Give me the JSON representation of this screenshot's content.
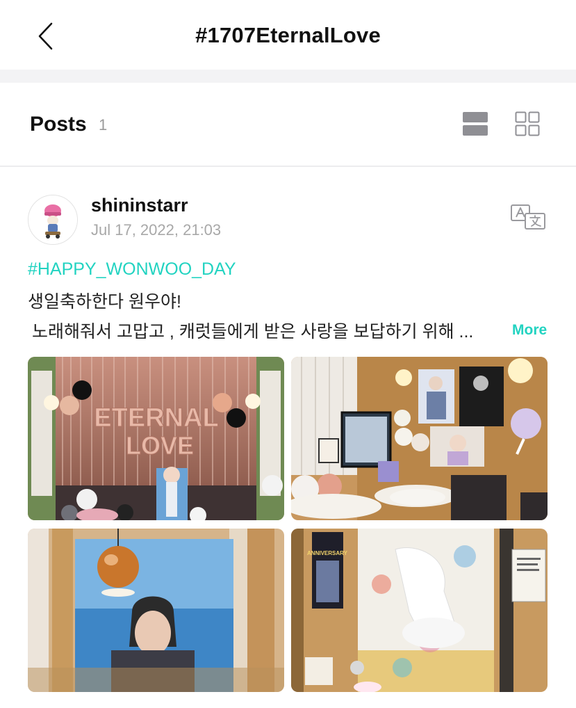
{
  "header": {
    "title": "#1707EternalLove",
    "back_icon": "chevron-left-icon"
  },
  "posts_section": {
    "label": "Posts",
    "count": "1",
    "view_list_icon": "list-view-icon",
    "view_grid_icon": "grid-view-icon"
  },
  "post": {
    "username": "shininstarr",
    "timestamp": "Jul 17, 2022, 21:03",
    "translate_icon": "translate-icon",
    "hashtag": "#HAPPY_WONWOO_DAY",
    "text_line1": "생일축하한다 원우야!",
    "text_line2": "노래해줘서 고맙고 , 캐럿들에게 받은 사랑을 보답하기 위해 ...",
    "more_label": "More",
    "photos": [
      {
        "name": "eternal-love-balloon-backdrop-photo",
        "balloon_text_1": "ETERNAL",
        "balloon_text_2": "LOVE"
      },
      {
        "name": "cafe-table-with-posters-photo"
      },
      {
        "name": "hanging-banner-with-lamp-photo"
      },
      {
        "name": "anniversary-poster-and-banner-photo",
        "poster_text": "ANNIVERSARY"
      }
    ]
  },
  "colors": {
    "accent": "#22d3c1",
    "muted": "#a8a8a8",
    "divider": "#ececee"
  }
}
